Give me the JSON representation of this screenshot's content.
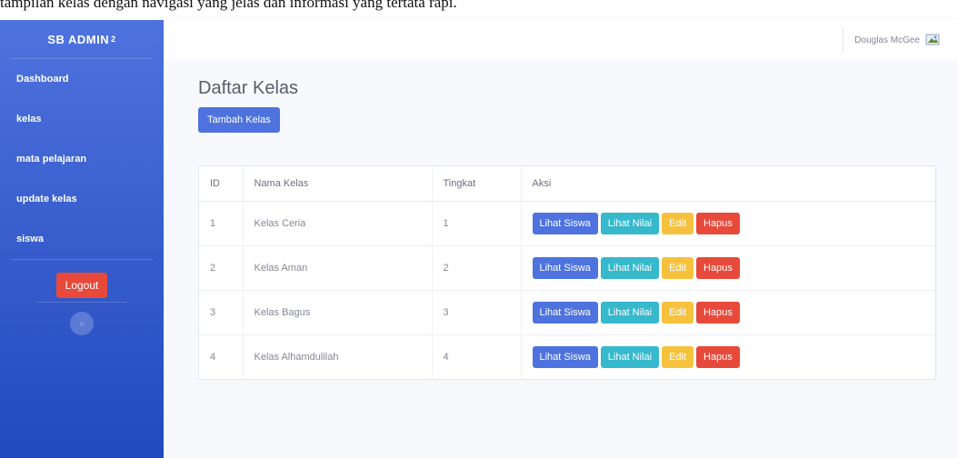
{
  "caption": {
    "text": "tampilan kelas dengan navigasi yang jelas dan informasi yang tertata rapi."
  },
  "sidebar": {
    "brand": "SB ADMIN",
    "brand_sup": "2",
    "items": [
      {
        "label": "Dashboard"
      },
      {
        "label": "kelas"
      },
      {
        "label": "mata pelajaran"
      },
      {
        "label": "update kelas"
      },
      {
        "label": "siswa"
      }
    ],
    "logout_label": "Logout"
  },
  "topbar": {
    "user_name": "Douglas McGee"
  },
  "main": {
    "title": "Daftar Kelas",
    "add_button": "Tambah Kelas",
    "table": {
      "headers": [
        "ID",
        "Nama Kelas",
        "Tingkat",
        "Aksi"
      ],
      "rows": [
        {
          "id": "1",
          "name": "Kelas Ceria",
          "level": "1"
        },
        {
          "id": "2",
          "name": "Kelas Aman",
          "level": "2"
        },
        {
          "id": "3",
          "name": "Kelas Bagus",
          "level": "3"
        },
        {
          "id": "4",
          "name": "Kelas Alhamdulilah",
          "level": "4"
        }
      ],
      "actions": {
        "view_students": "Lihat Siswa",
        "view_grades": "Lihat Nilai",
        "edit": "Edit",
        "delete": "Hapus"
      }
    }
  },
  "colors": {
    "sidebar_primary": "#4e73df",
    "primary": "#4e73df",
    "info": "#36b9cc",
    "warning": "#f6c23e",
    "danger": "#e74a3b"
  }
}
